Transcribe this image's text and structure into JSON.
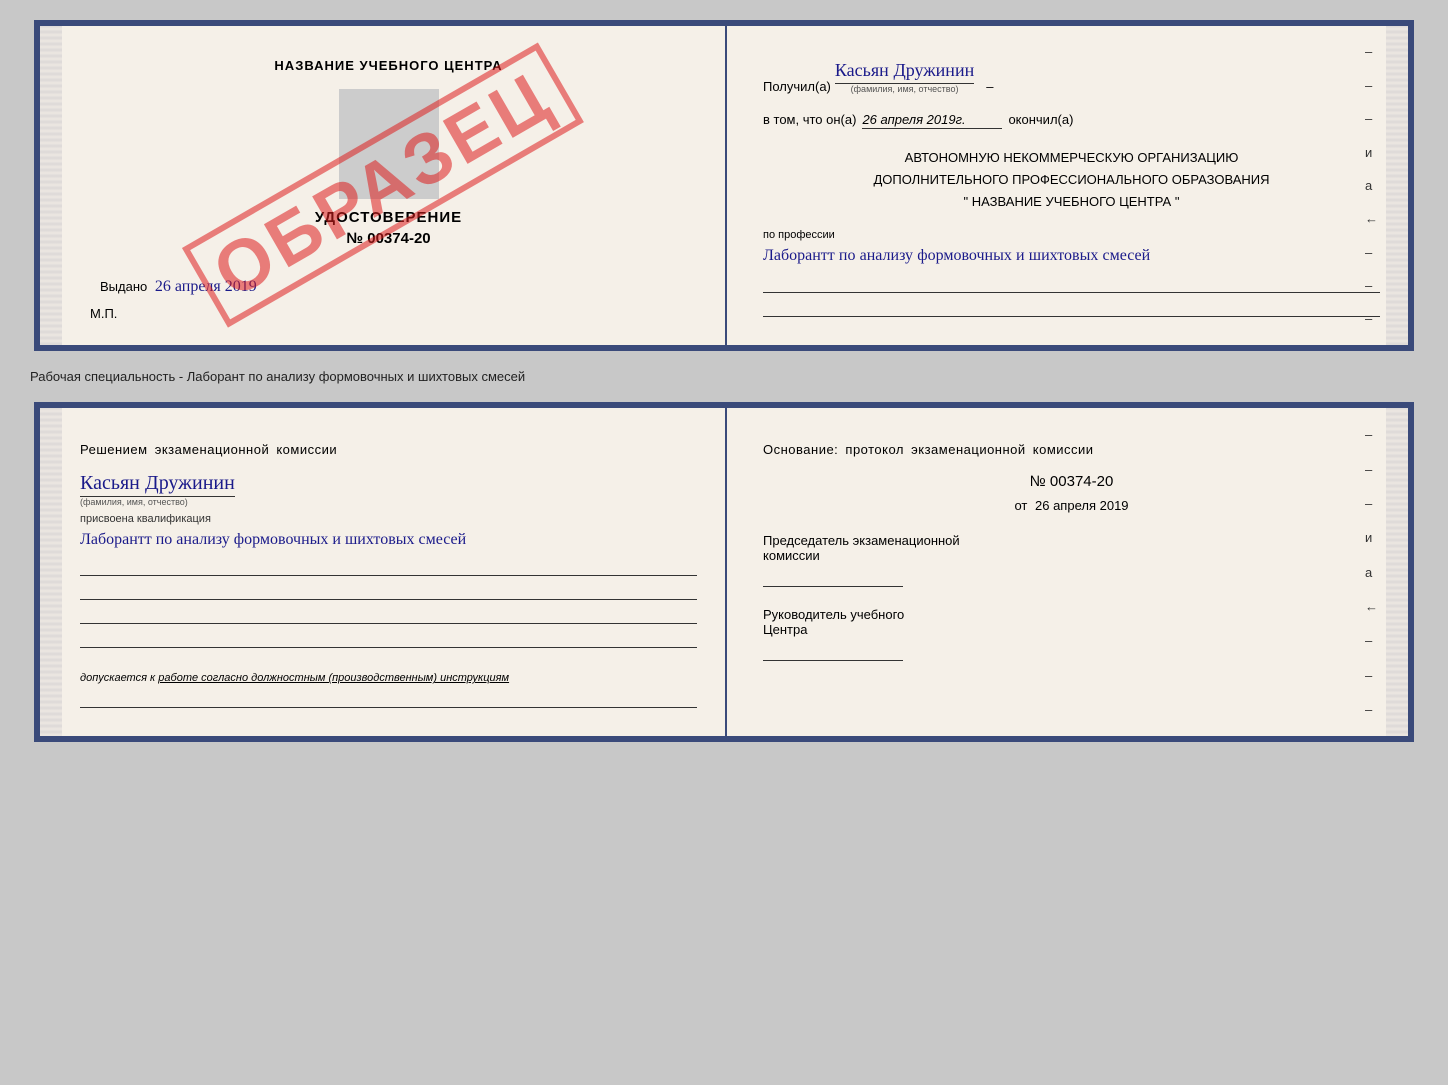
{
  "upper_card": {
    "left": {
      "center_name": "НАЗВАНИЕ УЧЕБНОГО ЦЕНТРА",
      "photo_alt": "фото",
      "cert_label": "УДОСТОВЕРЕНИЕ",
      "cert_number": "№ 00374-20",
      "issued_prefix": "Выдано",
      "issued_date": "26 апреля 2019",
      "mp_label": "М.П.",
      "stamp_text": "ОБРАЗЕЦ"
    },
    "right": {
      "received_prefix": "Получил(а)",
      "received_name": "Касьян Дружинин",
      "received_subtext": "(фамилия, имя, отчество)",
      "in_that_prefix": "в том, что он(а)",
      "in_that_date": "26 апреля 2019г.",
      "finished_label": "окончил(а)",
      "org_line1": "АВТОНОМНУЮ НЕКОММЕРЧЕСКУЮ ОРГАНИЗАЦИЮ",
      "org_line2": "ДОПОЛНИТЕЛЬНОГО ПРОФЕССИОНАЛЬНОГО ОБРАЗОВАНИЯ",
      "org_name": "\" НАЗВАНИЕ УЧЕБНОГО ЦЕНТРА \"",
      "profession_label": "по профессии",
      "profession_text": "Лаборантт по анализу формовочных и шихтовых смесей",
      "dashes": [
        "-",
        "-",
        "-",
        "и",
        "а",
        "←",
        "-",
        "-",
        "-"
      ]
    }
  },
  "middle": {
    "text": "Рабочая специальность - Лаборант по анализу формовочных и шихтовых смесей"
  },
  "lower_card": {
    "left": {
      "decision_text": "Решением  экзаменационной  комиссии",
      "person_name": "Касьян Дружинин",
      "name_subtext": "(фамилия, имя, отчество)",
      "qualification_prefix": "присвоена квалификация",
      "qualification_text": "Лаборантт по анализу формовочных и шихтовых смесей",
      "allowed_prefix": "допускается к",
      "allowed_text": "работе согласно должностным (производственным) инструкциям"
    },
    "right": {
      "basis_text": "Основание: протокол экзаменационной  комиссии",
      "protocol_number": "№  00374-20",
      "date_prefix": "от",
      "date_value": "26 апреля 2019",
      "chairman_line1": "Председатель экзаменационной",
      "chairman_line2": "комиссии",
      "director_line1": "Руководитель учебного",
      "director_line2": "Центра",
      "dashes": [
        "-",
        "-",
        "-",
        "и",
        "а",
        "←",
        "-",
        "-",
        "-"
      ]
    }
  }
}
